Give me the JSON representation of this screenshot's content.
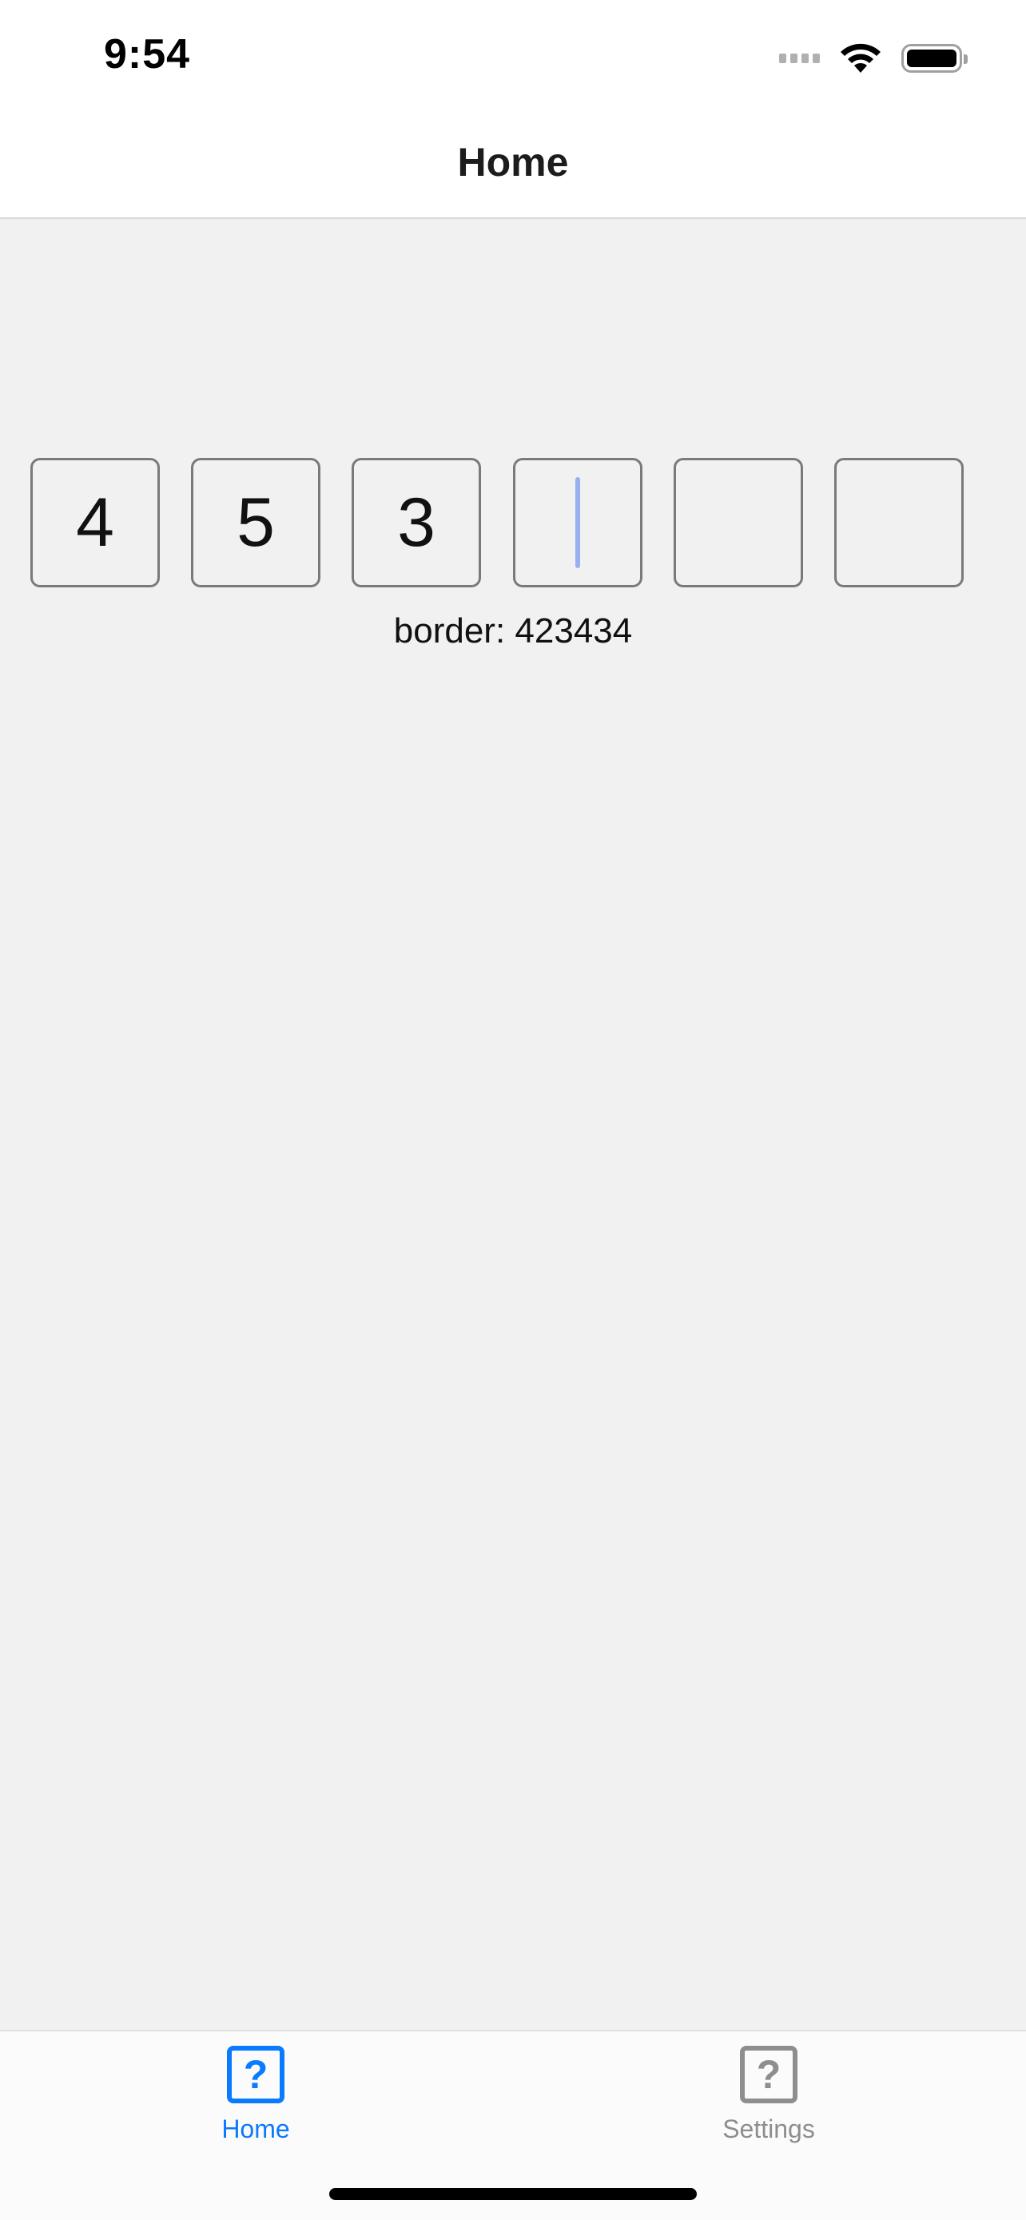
{
  "status_bar": {
    "time": "9:54",
    "icons": [
      "cellular-signal-icon",
      "wifi-icon",
      "battery-icon"
    ]
  },
  "nav": {
    "title": "Home"
  },
  "otp": {
    "digits": [
      "4",
      "5",
      "3",
      "",
      "",
      ""
    ],
    "focused_index": 3,
    "caption": "border: 423434"
  },
  "tabs": [
    {
      "label": "Home",
      "icon": "question-square-icon",
      "selected": true,
      "color": "#0a7aff"
    },
    {
      "label": "Settings",
      "icon": "question-square-icon",
      "selected": false,
      "color": "#8e8e8e"
    }
  ],
  "tab_icon_glyph": "?"
}
